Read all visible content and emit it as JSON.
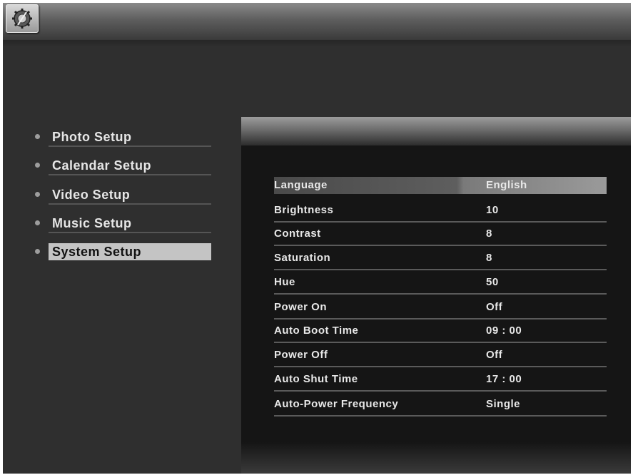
{
  "sidebar": {
    "items": [
      {
        "label": "Photo Setup"
      },
      {
        "label": "Calendar Setup"
      },
      {
        "label": "Video Setup"
      },
      {
        "label": "Music Setup"
      },
      {
        "label": "System Setup",
        "selected": true
      }
    ]
  },
  "settings": {
    "rows": [
      {
        "name": "Language",
        "value": "English",
        "selected": true
      },
      {
        "name": "Brightness",
        "value": "10"
      },
      {
        "name": "Contrast",
        "value": "8"
      },
      {
        "name": "Saturation",
        "value": "8"
      },
      {
        "name": "Hue",
        "value": "50"
      },
      {
        "name": "Power On",
        "value": "Off"
      },
      {
        "name": "Auto Boot Time",
        "value": "09 : 00"
      },
      {
        "name": "Power Off",
        "value": "Off"
      },
      {
        "name": "Auto Shut Time",
        "value": "17 : 00"
      },
      {
        "name": "Auto-Power Frequency",
        "value": "Single"
      }
    ]
  },
  "icons": {
    "top_left": "settings-gear-icon"
  },
  "colors": {
    "background": "#2f2f2f",
    "panel": "#151515",
    "highlight": "#c4c4c4"
  }
}
